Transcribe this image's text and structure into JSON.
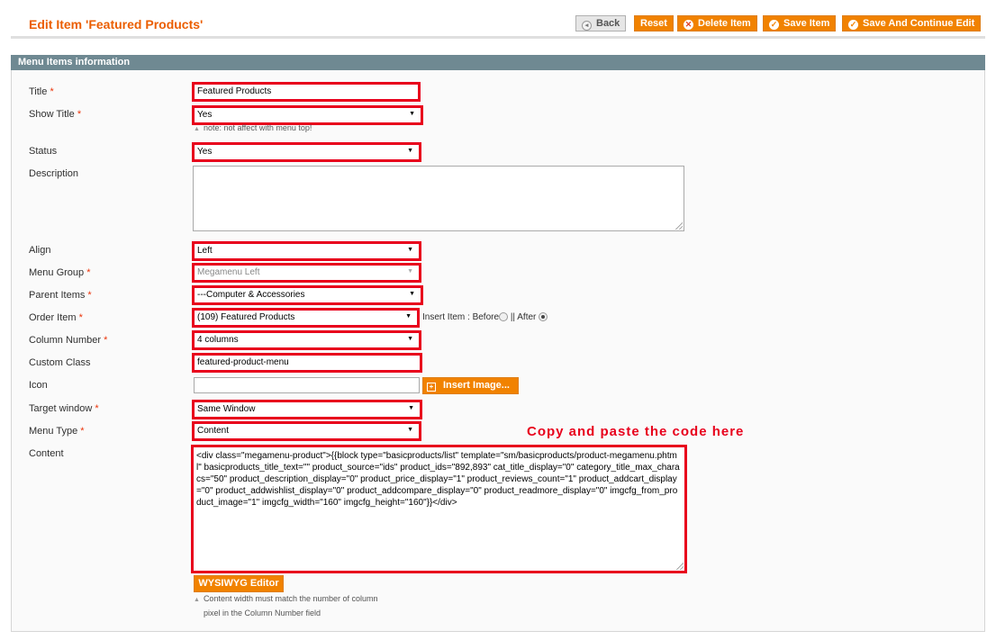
{
  "header": {
    "title": "Edit Item 'Featured Products'",
    "back_label": "Back",
    "reset_label": "Reset",
    "delete_label": "Delete Item",
    "save_label": "Save Item",
    "save_continue_label": "Save And Continue Edit"
  },
  "section": {
    "title": "Menu Items information"
  },
  "fields": {
    "title": {
      "label": "Title",
      "value": "Featured Products"
    },
    "show_title": {
      "label": "Show Title",
      "value": "Yes",
      "note": "note: not affect with menu top!"
    },
    "status": {
      "label": "Status",
      "value": "Yes"
    },
    "description": {
      "label": "Description",
      "value": ""
    },
    "align": {
      "label": "Align",
      "value": "Left"
    },
    "menu_group": {
      "label": "Menu Group",
      "value": "Megamenu Left"
    },
    "parent_items": {
      "label": "Parent Items",
      "value": "---Computer & Accessories"
    },
    "order_item": {
      "label": "Order Item",
      "value": "(109) Featured Products",
      "insert_label": "Insert Item : Before",
      "after_label": "|| After"
    },
    "column_number": {
      "label": "Column Number",
      "value": "4 columns"
    },
    "custom_class": {
      "label": "Custom Class",
      "value": "featured-product-menu"
    },
    "icon": {
      "label": "Icon",
      "value": "",
      "insert_image_label": "Insert Image..."
    },
    "target_window": {
      "label": "Target window",
      "value": "Same Window"
    },
    "menu_type": {
      "label": "Menu Type",
      "value": "Content"
    },
    "content": {
      "label": "Content",
      "value": "<div class=\"megamenu-product\">{{block type=\"basicproducts/list\" template=\"sm/basicproducts/product-megamenu.phtml\" basicproducts_title_text=\"\" product_source=\"ids\" product_ids=\"892,893\" cat_title_display=\"0\" category_title_max_characs=\"50\" product_description_display=\"0\" product_price_display=\"1\" product_reviews_count=\"1\" product_addcart_display=\"0\" product_addwishlist_display=\"0\" product_addcompare_display=\"0\" product_readmore_display=\"0\" imgcfg_from_product_image=\"1\" imgcfg_width=\"160\" imgcfg_height=\"160\"}}</div>",
      "wysiwyg_label": "WYSIWYG Editor",
      "note_line1": "Content width must match the number of column",
      "note_line2": "pixel in the Column Number field"
    }
  },
  "required_mark": "*",
  "annotation": "Copy and paste the code here",
  "colors": {
    "accent": "#f18200",
    "title": "#eb5e00",
    "highlight": "#e8001c",
    "section_bar": "#6f8992"
  }
}
